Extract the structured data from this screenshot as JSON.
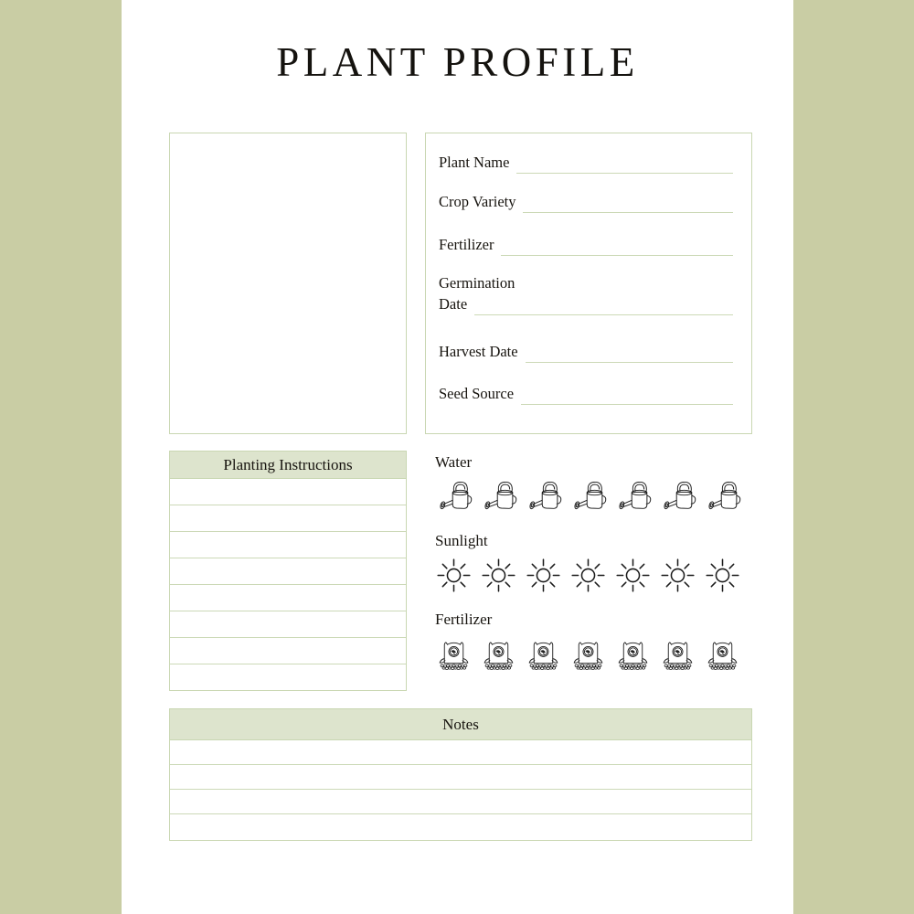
{
  "theme": {
    "page_background": "#ffffff",
    "outer_background": "#c9cda4",
    "border_green": "#c9d7b2",
    "header_fill": "#dde4cd",
    "text_color": "#17140f"
  },
  "header": {
    "title": "PLANT PROFILE"
  },
  "photo": {
    "placeholder_name": "plant-photo-placeholder"
  },
  "details": {
    "fields": [
      {
        "label": "Plant Name",
        "value": "",
        "name": "plant-name"
      },
      {
        "label": "Crop Variety",
        "value": "",
        "name": "crop-variety"
      },
      {
        "label": "Fertilizer",
        "value": "",
        "name": "fertilizer"
      },
      {
        "label": "Germination",
        "label2": "Date",
        "value": "",
        "name": "germination-date"
      },
      {
        "label": "Harvest Date",
        "value": "",
        "name": "harvest-date"
      },
      {
        "label": "Seed Source",
        "value": "",
        "name": "seed-source"
      }
    ]
  },
  "planting": {
    "header": "Planting Instructions",
    "rows": [
      "",
      "",
      "",
      "",
      "",
      "",
      "",
      ""
    ]
  },
  "ratings": [
    {
      "label": "Water",
      "icon": "watering-can-icon",
      "count": 7,
      "selected": 0
    },
    {
      "label": "Sunlight",
      "icon": "sun-icon",
      "count": 7,
      "selected": 0
    },
    {
      "label": "Fertilizer",
      "icon": "fertilizer-bag-icon",
      "count": 7,
      "selected": 0
    }
  ],
  "notes": {
    "header": "Notes",
    "rows": [
      "",
      "",
      "",
      ""
    ]
  }
}
